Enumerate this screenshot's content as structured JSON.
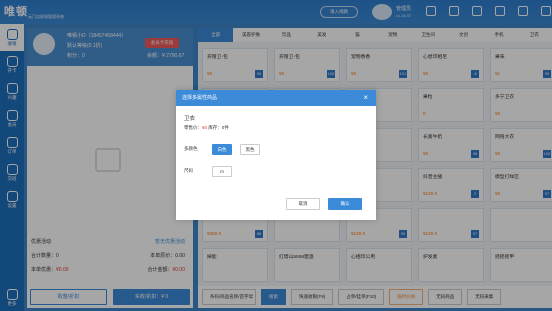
{
  "app": {
    "logo": "唯顿",
    "logo_sub": "云门店收银管理系统",
    "login": "请入线路",
    "username": "管理员",
    "version": "v1.34.57",
    "top_icons": [
      "bell-icon",
      "gift-icon",
      "home-icon",
      "clock-icon",
      "minimize-icon",
      "close-icon"
    ]
  },
  "sidebar": {
    "items": [
      {
        "label": "收银",
        "icon": "cashier-icon"
      },
      {
        "label": "开卡",
        "icon": "card-icon"
      },
      {
        "label": "兴趣",
        "icon": "heart-icon"
      },
      {
        "label": "会员",
        "icon": "member-icon"
      },
      {
        "label": "订单",
        "icon": "order-icon"
      },
      {
        "label": "交班",
        "icon": "handover-icon"
      },
      {
        "label": "设置",
        "icon": "settings-icon"
      },
      {
        "label": "更多",
        "icon": "more-icon"
      }
    ]
  },
  "member": {
    "name": "唯顿小D（18457458444）",
    "level": "默认等级(0.1折)",
    "points": "积分：0",
    "balance": "余额：¥ 2790.67",
    "recharge_label": "会员卡充值"
  },
  "summary": {
    "promo": "优惠活动",
    "promo_value": "暂无优惠活动",
    "count_label": "合计数量：0",
    "original_label": "本单原价：0.00",
    "discount_label": "本单优惠：",
    "discount_value": "¥0.00",
    "total_label": "合计金额：",
    "total_value": "¥0.00"
  },
  "left_footer": {
    "clear_label": "取整/折扣",
    "pay_label": "实收/折扣：¥ 0"
  },
  "categories": [
    "全部",
    "美容护肤",
    "饮品",
    "美发",
    "猫",
    "宠物",
    "卫生间",
    "文创",
    "手机",
    "卫衣"
  ],
  "products": [
    {
      "name": "买赠卫-包",
      "price": "¥0",
      "stock": "90"
    },
    {
      "name": "买赠卫-包",
      "price": "¥0",
      "stock": "100"
    },
    {
      "name": "宠物香香",
      "price": "¥0",
      "stock": "101"
    },
    {
      "name": "心想印相尼",
      "price": "¥0",
      "stock": "-6"
    },
    {
      "name": "果味",
      "price": "¥1",
      "stock": "99"
    },
    {
      "name": "",
      "price": "",
      "stock": ""
    },
    {
      "name": "",
      "price": "",
      "stock": ""
    },
    {
      "name": "",
      "price": "",
      "stock": ""
    },
    {
      "name": "果粒",
      "price": "0",
      "stock": ""
    },
    {
      "name": "多宁卫衣",
      "price": "¥0",
      "stock": ""
    },
    {
      "name": "",
      "price": "",
      "stock": ""
    },
    {
      "name": "",
      "price": "",
      "stock": ""
    },
    {
      "name": "",
      "price": "",
      "stock": ""
    },
    {
      "name": "长富牛奶",
      "price": "¥0",
      "stock": "98"
    },
    {
      "name": "网络大衣",
      "price": "¥0",
      "stock": "100"
    },
    {
      "name": "",
      "price": "",
      "stock": ""
    },
    {
      "name": "",
      "price": "",
      "stock": ""
    },
    {
      "name": "",
      "price": "",
      "stock": ""
    },
    {
      "name": "抖音主播",
      "price": "¥120.0",
      "stock": "2"
    },
    {
      "name": "模型打样区",
      "price": "¥0",
      "stock": "97"
    },
    {
      "name": "",
      "price": "¥360.0",
      "stock": "88"
    },
    {
      "name": "",
      "price": "",
      "stock": ""
    },
    {
      "name": "",
      "price": "¥120.0",
      "stock": "99"
    },
    {
      "name": "",
      "price": "¥120.0",
      "stock": "97"
    },
    {
      "name": "",
      "price": "",
      "stock": ""
    },
    {
      "name": "掉能",
      "price": "",
      "stock": ""
    },
    {
      "name": "红墙山5558建盏",
      "price": "",
      "stock": ""
    },
    {
      "name": "心相印公用",
      "price": "",
      "stock": ""
    },
    {
      "name": "护发素",
      "price": "",
      "stock": ""
    },
    {
      "name": "摇摇摇甲",
      "price": "",
      "stock": ""
    }
  ],
  "right_footer": {
    "search_placeholder": "条码/商品名称/首字母",
    "search_label": "搜索",
    "btn1": "快速收银(F9)",
    "btn2": "占单/挂单(F10)",
    "btn3": "临时价格",
    "btn4": "无码商品",
    "btn5": "无码采集"
  },
  "modal": {
    "title": "选择多属性商品",
    "product_name": "卫衣",
    "price_label": "零售价：",
    "price_value": "¥0",
    "stock_label": "库存：",
    "stock_value": "0件",
    "attr1_label": "多颜色",
    "attr1_values": [
      "白色",
      "黑色"
    ],
    "attr2_label": "尺码",
    "attr2_values": [
      "m"
    ],
    "cancel_label": "取消",
    "confirm_label": "确认"
  }
}
